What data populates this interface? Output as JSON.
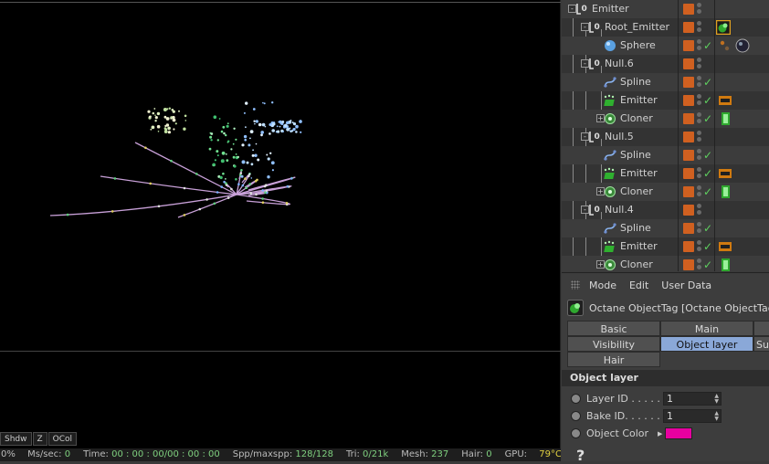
{
  "viewport": {
    "render_buttons": [
      "Shdw",
      "Z",
      "OCol"
    ]
  },
  "status_bar": {
    "items": [
      {
        "label": "0%",
        "value": ""
      },
      {
        "label": "Ms/sec:",
        "value": "0"
      },
      {
        "label": "Time:",
        "value": "00 : 00 : 00/00 : 00 : 00"
      },
      {
        "label": "Spp/maxspp:",
        "value": "128/128"
      },
      {
        "label": "Tri:",
        "value": "0/21k"
      },
      {
        "label": "Mesh:",
        "value": "237"
      },
      {
        "label": "Hair:",
        "value": "0"
      },
      {
        "label": "GPU:",
        "value": ""
      }
    ],
    "gpu_temp": "79°C"
  },
  "object_manager": {
    "objects": [
      {
        "name": "Emitter",
        "type": "null",
        "level": 0,
        "expand": "-",
        "check": false,
        "tag": "none"
      },
      {
        "name": "Root_Emitter",
        "type": "null",
        "level": 1,
        "expand": "-",
        "check": false,
        "tag": "octane-object-tag"
      },
      {
        "name": "Sphere",
        "type": "sphere",
        "level": 2,
        "expand": "",
        "check": true,
        "tag": "material-ball"
      },
      {
        "name": "Null.6",
        "type": "null",
        "level": 1,
        "expand": "-",
        "check": false,
        "tag": "none"
      },
      {
        "name": "Spline",
        "type": "spline",
        "level": 2,
        "expand": "",
        "check": true,
        "tag": "none"
      },
      {
        "name": "Emitter",
        "type": "emitter",
        "level": 2,
        "expand": "",
        "check": true,
        "tag": "emitter-tag"
      },
      {
        "name": "Cloner",
        "type": "cloner",
        "level": 2,
        "expand": "+",
        "check": true,
        "tag": "mograph-tag"
      },
      {
        "name": "Null.5",
        "type": "null",
        "level": 1,
        "expand": "-",
        "check": false,
        "tag": "none"
      },
      {
        "name": "Spline",
        "type": "spline",
        "level": 2,
        "expand": "",
        "check": true,
        "tag": "none"
      },
      {
        "name": "Emitter",
        "type": "emitter",
        "level": 2,
        "expand": "",
        "check": true,
        "tag": "emitter-tag"
      },
      {
        "name": "Cloner",
        "type": "cloner",
        "level": 2,
        "expand": "+",
        "check": true,
        "tag": "mograph-tag"
      },
      {
        "name": "Null.4",
        "type": "null",
        "level": 1,
        "expand": "-",
        "check": false,
        "tag": "none"
      },
      {
        "name": "Spline",
        "type": "spline",
        "level": 2,
        "expand": "",
        "check": true,
        "tag": "none"
      },
      {
        "name": "Emitter",
        "type": "emitter",
        "level": 2,
        "expand": "",
        "check": true,
        "tag": "emitter-tag"
      },
      {
        "name": "Cloner",
        "type": "cloner",
        "level": 2,
        "expand": "+",
        "check": true,
        "tag": "mograph-tag"
      }
    ],
    "layer_color": "#d06020",
    "check_color": "#5fd05f"
  },
  "attributes": {
    "menu": [
      "Mode",
      "Edit",
      "User Data"
    ],
    "title": "Octane ObjectTag [Octane ObjectTag]",
    "tabs": [
      {
        "label": "Basic",
        "active": false
      },
      {
        "label": "Main",
        "active": false
      },
      {
        "label": "Visibility",
        "active": false
      },
      {
        "label": "Object layer",
        "active": true
      },
      {
        "label": "Su",
        "active": false
      },
      {
        "label": "Hair",
        "active": false
      }
    ],
    "section_title": "Object layer",
    "params": {
      "layer_id": {
        "label": "Layer ID . . . . . .",
        "value": "1"
      },
      "bake_id": {
        "label": "Bake ID. . . . . . .",
        "value": "1"
      },
      "object_color": {
        "label": "Object Color",
        "color": "#e800a0"
      }
    },
    "help_glyph": "?"
  }
}
